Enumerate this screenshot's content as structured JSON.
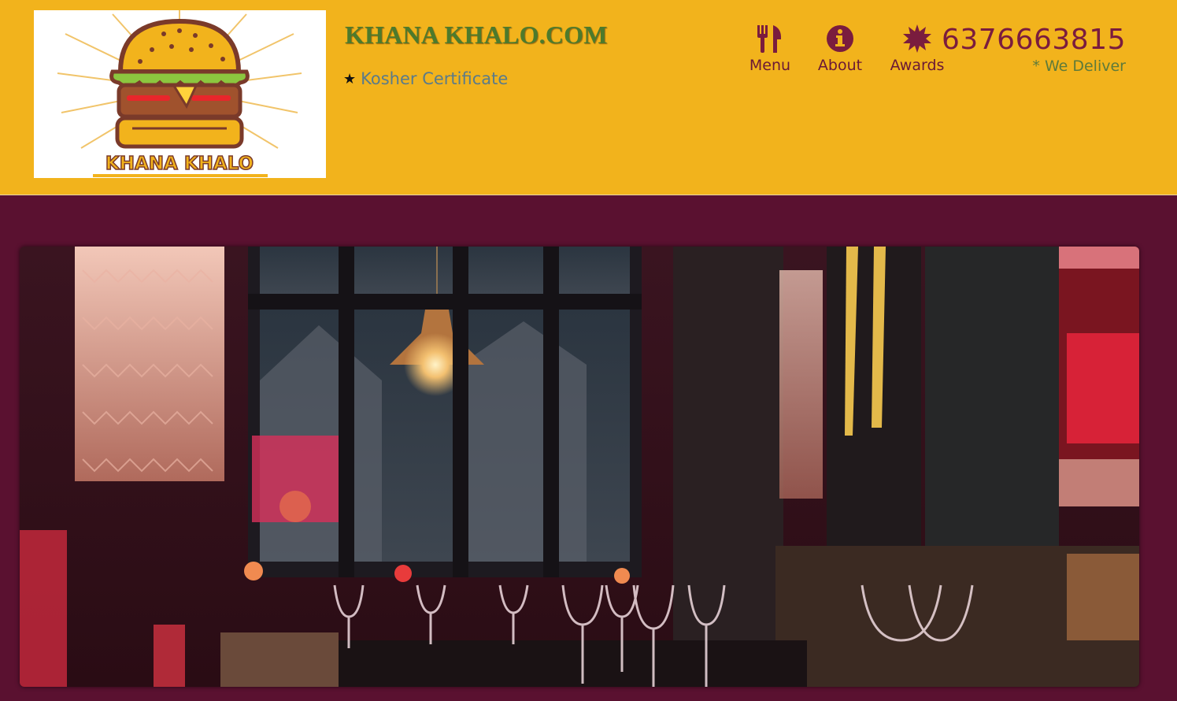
{
  "header": {
    "logo_text": "KHANA KHALO",
    "site_title": "KHANA KHALO.COM",
    "certificate": {
      "icon": "star-icon",
      "label": "Kosher Certificate"
    },
    "nav": [
      {
        "label": "Menu",
        "icon": "fork-knife-icon"
      },
      {
        "label": "About",
        "icon": "info-circle-icon"
      },
      {
        "label": "Awards",
        "icon": "badge-burst-icon"
      }
    ],
    "phone": "6376663815",
    "delivery_note": "* We Deliver"
  },
  "hero": {
    "image": "restaurant-interior-photo"
  },
  "colors": {
    "header_bg": "#f2b31c",
    "page_bg": "#5a1130",
    "accent": "#7a1c3e",
    "title_green": "#4d7a2c"
  }
}
